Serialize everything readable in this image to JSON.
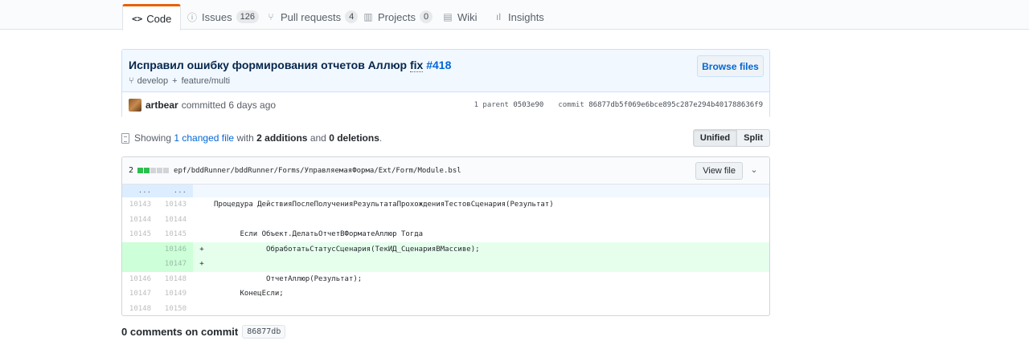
{
  "tabs": [
    {
      "label": "Code",
      "icon": "code-icon",
      "glyph": "<>",
      "selected": true
    },
    {
      "label": "Issues",
      "icon": "issue-icon",
      "glyph": "ⓘ",
      "count": "126"
    },
    {
      "label": "Pull requests",
      "icon": "pull-request-icon",
      "glyph": "⑂",
      "count": "4"
    },
    {
      "label": "Projects",
      "icon": "project-icon",
      "glyph": "▥",
      "count": "0"
    },
    {
      "label": "Wiki",
      "icon": "book-icon",
      "glyph": "▤"
    },
    {
      "label": "Insights",
      "icon": "graph-icon",
      "glyph": "ıl"
    }
  ],
  "commit": {
    "title": "Исправил ошибку формирования отчетов Аллюр",
    "fix_word": "fix",
    "issue_ref": "#418",
    "browse_label": "Browse files",
    "branch_from": "develop",
    "branch_plus": "+",
    "branch_to": "feature/multi",
    "author": "artbear",
    "committed_text": "committed 6 days ago",
    "parent_label": "1 parent",
    "parent_sha": "0503e90",
    "commit_label": "commit",
    "commit_sha": "86877db5f069e6bce895c287e294b401788636f9"
  },
  "toc": {
    "showing": "Showing",
    "changed": "1 changed file",
    "with": "with",
    "additions": "2 additions",
    "and": "and",
    "deletions": "0 deletions",
    "period": ".",
    "unified_label": "Unified",
    "split_label": "Split"
  },
  "file": {
    "diffstat_count": "2",
    "path": "epf/bddRunner/bddRunner/Forms/УправляемаяФорма/Ext/Form/Module.bsl",
    "view_label": "View file",
    "colors": {
      "add": "#e6ffed",
      "add_num": "#cdffd8",
      "hunk": "#f1f8ff"
    },
    "lines": [
      {
        "type": "hunk",
        "old": "...",
        "new": "...",
        "sign": "",
        "code": ""
      },
      {
        "type": "ctx",
        "old": "10143",
        "new": "10143",
        "sign": "",
        "code": "Процедура ДействияПослеПолученияРезультатаПрохожденияТестовСценария(Результат)"
      },
      {
        "type": "ctx",
        "old": "10144",
        "new": "10144",
        "sign": "",
        "code": ""
      },
      {
        "type": "ctx",
        "old": "10145",
        "new": "10145",
        "sign": "",
        "code": "\tЕсли Объект.ДелатьОтчетВФорматеАллюр Тогда"
      },
      {
        "type": "add",
        "old": "",
        "new": "10146",
        "sign": "+",
        "code": "\t\tОбработатьСтатусСценария(ТекИД_СценарияВМассиве);"
      },
      {
        "type": "add",
        "old": "",
        "new": "10147",
        "sign": "+",
        "code": ""
      },
      {
        "type": "ctx",
        "old": "10146",
        "new": "10148",
        "sign": "",
        "code": "\t\tОтчетАллюр(Результат);"
      },
      {
        "type": "ctx",
        "old": "10147",
        "new": "10149",
        "sign": "",
        "code": "\tКонецЕсли;"
      },
      {
        "type": "ctx",
        "old": "10148",
        "new": "10150",
        "sign": "",
        "code": ""
      }
    ]
  },
  "comments": {
    "label": "0 comments on commit",
    "sha": "86877db"
  }
}
